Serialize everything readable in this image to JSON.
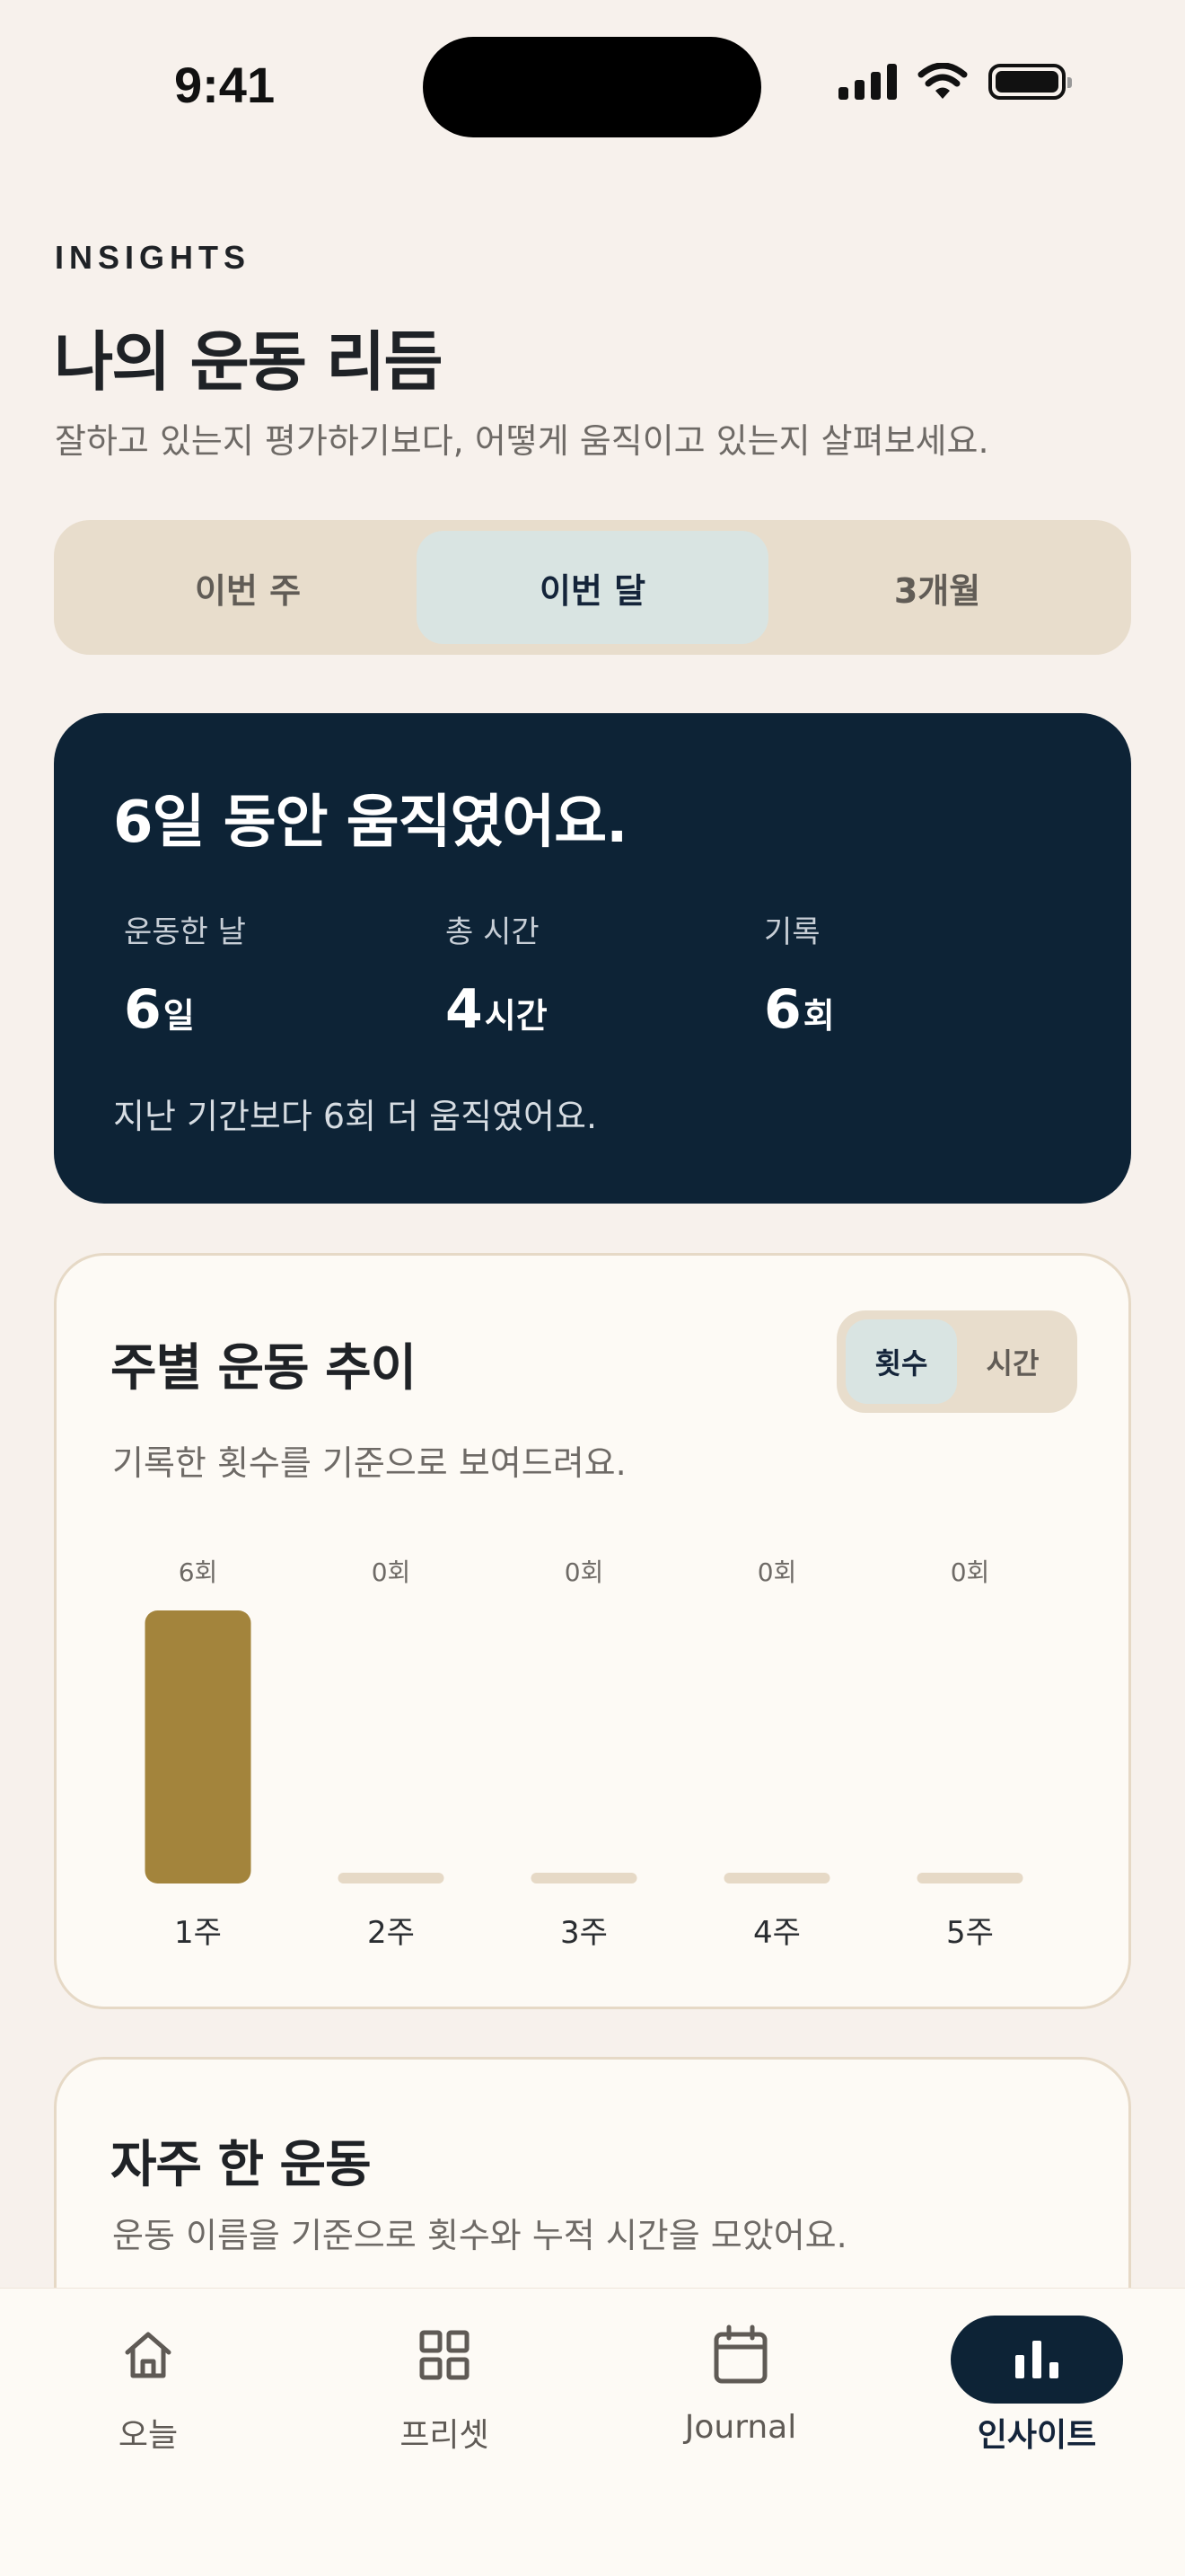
{
  "status": {
    "time": "9:41"
  },
  "header": {
    "eyebrow": "INSIGHTS",
    "title": "나의 운동 리듬",
    "subtitle": "잘하고 있는지 평가하기보다, 어떻게 움직이고 있는지 살펴보세요."
  },
  "period_tabs": [
    {
      "label": "이번 주",
      "active": false
    },
    {
      "label": "이번 달",
      "active": true
    },
    {
      "label": "3개월",
      "active": false
    }
  ],
  "summary": {
    "title": "6일 동안 움직였어요.",
    "stats": [
      {
        "label": "운동한 날",
        "value": "6",
        "unit": "일"
      },
      {
        "label": "총 시간",
        "value": "4",
        "unit": "시간"
      },
      {
        "label": "기록",
        "value": "6",
        "unit": "회"
      }
    ],
    "note": "지난 기간보다 6회 더 움직였어요."
  },
  "trend": {
    "title": "주별 운동 추이",
    "description": "기록한 횟수를 기준으로 보여드려요.",
    "toggle": [
      {
        "label": "횟수",
        "active": true
      },
      {
        "label": "시간",
        "active": false
      }
    ]
  },
  "chart_data": {
    "type": "bar",
    "categories": [
      "1주",
      "2주",
      "3주",
      "4주",
      "5주"
    ],
    "values": [
      6,
      0,
      0,
      0,
      0
    ],
    "value_labels": [
      "6회",
      "0회",
      "0회",
      "0회",
      "0회"
    ],
    "ylim": [
      0,
      6
    ],
    "grid": false,
    "bar_color": "#A3843C",
    "empty_bar_color": "#E6D9C6"
  },
  "frequent": {
    "title": "자주 한 운동",
    "description": "운동 이름을 기준으로 횟수와 누적 시간을 모았어요."
  },
  "tabbar": [
    {
      "label": "오늘",
      "icon": "home-icon",
      "active": false
    },
    {
      "label": "프리셋",
      "icon": "grid-icon",
      "active": false
    },
    {
      "label": "Journal",
      "icon": "calendar-icon",
      "active": false
    },
    {
      "label": "인사이트",
      "icon": "bar-chart-icon",
      "active": true
    }
  ],
  "colors": {
    "background": "#F7F1EC",
    "navy": "#0D2336",
    "accent_bar": "#A3843C",
    "segment_bg": "#E8DDCC",
    "segment_active": "#D9E4E2"
  }
}
